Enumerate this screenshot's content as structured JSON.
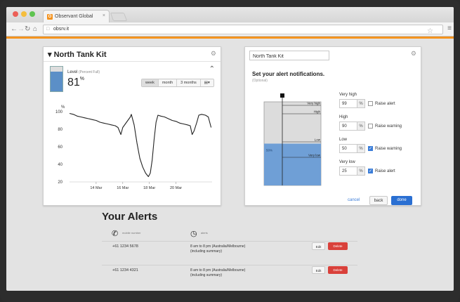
{
  "browser": {
    "tab_title": "Observant Global",
    "tab_favicon_letter": "O",
    "tab_close": "×",
    "url": "obsrv.it",
    "accent_color": "#f4931f"
  },
  "tank_card": {
    "title": "North Tank Kit",
    "level_label": "Level",
    "level_sublabel": "(Percent Full)",
    "level_value": "81",
    "level_unit": "%",
    "level_fraction": 0.81,
    "ranges": [
      "week",
      "month",
      "3 months"
    ],
    "active_range": "week",
    "range_menu_icon": "bar-chart-icon"
  },
  "chart_data": {
    "type": "line",
    "ylabel": "%",
    "ylim": [
      20,
      100
    ],
    "yticks": [
      100,
      80,
      60,
      40,
      20
    ],
    "xticks": [
      "14 Mar",
      "16 Mar",
      "18 Mar",
      "20 Mar"
    ],
    "x_start": "12 Mar",
    "x_end": "21 Mar",
    "series": [
      {
        "color": "#222222",
        "points": [
          [
            0.0,
            98
          ],
          [
            0.4,
            97
          ],
          [
            0.8,
            95
          ],
          [
            1.2,
            94
          ],
          [
            1.6,
            93
          ],
          [
            2.0,
            92
          ],
          [
            2.4,
            91
          ],
          [
            2.8,
            90
          ],
          [
            3.2,
            88
          ],
          [
            3.6,
            87
          ],
          [
            4.0,
            86
          ],
          [
            4.4,
            85
          ],
          [
            4.8,
            84
          ],
          [
            5.1,
            82
          ],
          [
            5.4,
            74
          ],
          [
            5.6,
            82
          ],
          [
            6.0,
            88
          ],
          [
            6.4,
            94
          ],
          [
            6.5,
            97
          ],
          [
            6.8,
            85
          ],
          [
            7.1,
            64
          ],
          [
            7.4,
            47
          ],
          [
            7.7,
            37
          ],
          [
            8.0,
            30
          ],
          [
            8.3,
            26
          ],
          [
            8.5,
            30
          ],
          [
            8.7,
            45
          ],
          [
            8.9,
            68
          ],
          [
            9.1,
            88
          ],
          [
            9.3,
            96
          ],
          [
            9.6,
            95
          ],
          [
            10.0,
            94
          ],
          [
            10.4,
            92
          ],
          [
            10.8,
            90
          ],
          [
            11.2,
            89
          ],
          [
            11.6,
            87
          ],
          [
            12.0,
            86
          ],
          [
            12.4,
            85
          ],
          [
            12.7,
            84
          ],
          [
            12.9,
            74
          ],
          [
            13.1,
            78
          ],
          [
            13.4,
            88
          ],
          [
            13.6,
            96
          ],
          [
            13.9,
            97
          ],
          [
            14.3,
            96
          ],
          [
            14.6,
            94
          ],
          [
            14.9,
            82
          ]
        ]
      }
    ]
  },
  "alert_card": {
    "name_value": "North Tank Kit",
    "heading": "Set your alert notifications.",
    "optional": "(Optional)",
    "tank_lines": [
      "Very high",
      "High",
      "Low",
      "Very low"
    ],
    "tank_level_text": "50%",
    "tank_fill_fraction": 0.5,
    "thresholds": [
      {
        "label": "Very high",
        "value": "99",
        "unit": "%",
        "checked": false,
        "text": "Raise alert"
      },
      {
        "label": "High",
        "value": "90",
        "unit": "%",
        "checked": false,
        "text": "Raise warning"
      },
      {
        "label": "Low",
        "value": "50",
        "unit": "%",
        "checked": true,
        "text": "Raise warning"
      },
      {
        "label": "Very low",
        "value": "25",
        "unit": "%",
        "checked": true,
        "text": "Raise alert"
      }
    ],
    "cancel": "cancel",
    "back": "back",
    "done": "done"
  },
  "alerts": {
    "title": "Your Alerts",
    "phone_col_label": "mobile number",
    "time_col_label": "alerts",
    "rows": [
      {
        "phone": "+61 1234 5678",
        "time": "8 am to 8 pm (Australia/Melbourne)",
        "summary": "(including summary)",
        "edit": "Edit",
        "delete": "Delete"
      },
      {
        "phone": "+61 1234 4321",
        "time": "8 am to 8 pm (Australia/Melbourne)",
        "summary": "(including summary)",
        "edit": "Edit",
        "delete": "Delete"
      }
    ]
  }
}
